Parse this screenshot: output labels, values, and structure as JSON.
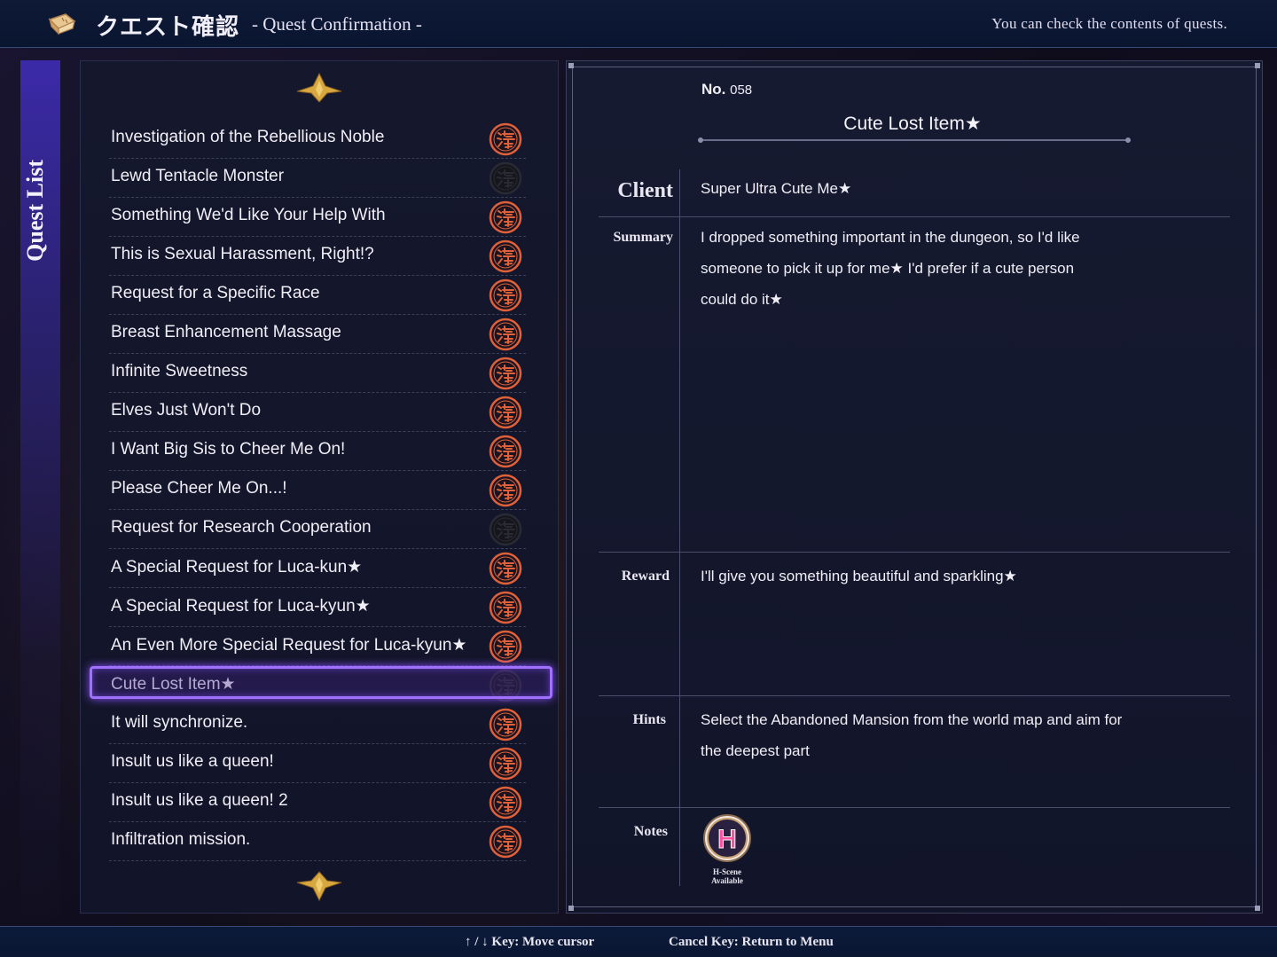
{
  "header": {
    "title_jp": "クエスト確認",
    "title_en": "- Quest Confirmation -",
    "hint": "You can check the contents of quests."
  },
  "side_tab": {
    "label": "Quest List"
  },
  "quests": [
    {
      "name": "Investigation of the Rebellious Noble",
      "status": "available"
    },
    {
      "name": "Lewd Tentacle Monster",
      "status": "inactive"
    },
    {
      "name": "Something We'd Like Your Help With",
      "status": "available"
    },
    {
      "name": "This is Sexual Harassment, Right!?",
      "status": "available"
    },
    {
      "name": "Request for a Specific Race",
      "status": "available"
    },
    {
      "name": "Breast Enhancement Massage",
      "status": "available"
    },
    {
      "name": "Infinite Sweetness",
      "status": "available"
    },
    {
      "name": "Elves Just Won't Do",
      "status": "available"
    },
    {
      "name": "I Want Big Sis to Cheer Me On!",
      "status": "available"
    },
    {
      "name": "Please Cheer Me On...!",
      "status": "available"
    },
    {
      "name": "Request for Research Cooperation",
      "status": "inactive"
    },
    {
      "name": "A Special Request for Luca-kun★",
      "status": "available"
    },
    {
      "name": "A Special Request for Luca-kyun★",
      "status": "available"
    },
    {
      "name": "An Even More Special Request for Luca-kyun★",
      "status": "available"
    },
    {
      "name": "Cute Lost Item★",
      "status": "inactive"
    },
    {
      "name": "It will synchronize.",
      "status": "available"
    },
    {
      "name": "Insult us like a queen!",
      "status": "available"
    },
    {
      "name": "Insult us like a queen! 2",
      "status": "available"
    },
    {
      "name": "Infiltration mission.",
      "status": "available"
    }
  ],
  "selected_index": 14,
  "detail": {
    "no_label": "No.",
    "no_value": "058",
    "title": "Cute Lost Item★",
    "client_label": "Client",
    "client": "Super Ultra Cute Me★",
    "summary_label": "Summary",
    "summary_lines": [
      "I dropped something important in the dungeon, so I'd like",
      "someone to pick it up for me★ I'd prefer if a cute person",
      "could do it★"
    ],
    "reward_label": "Reward",
    "reward": "I'll give you something beautiful and sparkling★",
    "hints_label": "Hints",
    "hints_lines": [
      "Select the Abandoned Mansion from the world map and aim for",
      "the deepest part"
    ],
    "notes_label": "Notes",
    "notes_badge_letter": "H",
    "notes_badge_caption_1": "H-Scene",
    "notes_badge_caption_2": "Available"
  },
  "footer": {
    "move": "↑ / ↓ Key: Move cursor",
    "cancel": "Cancel Key: Return to Menu"
  },
  "colors": {
    "accent_selection": "#a070ff",
    "badge_orange": "#e0603a",
    "badge_pink": "#ff4fa0"
  }
}
